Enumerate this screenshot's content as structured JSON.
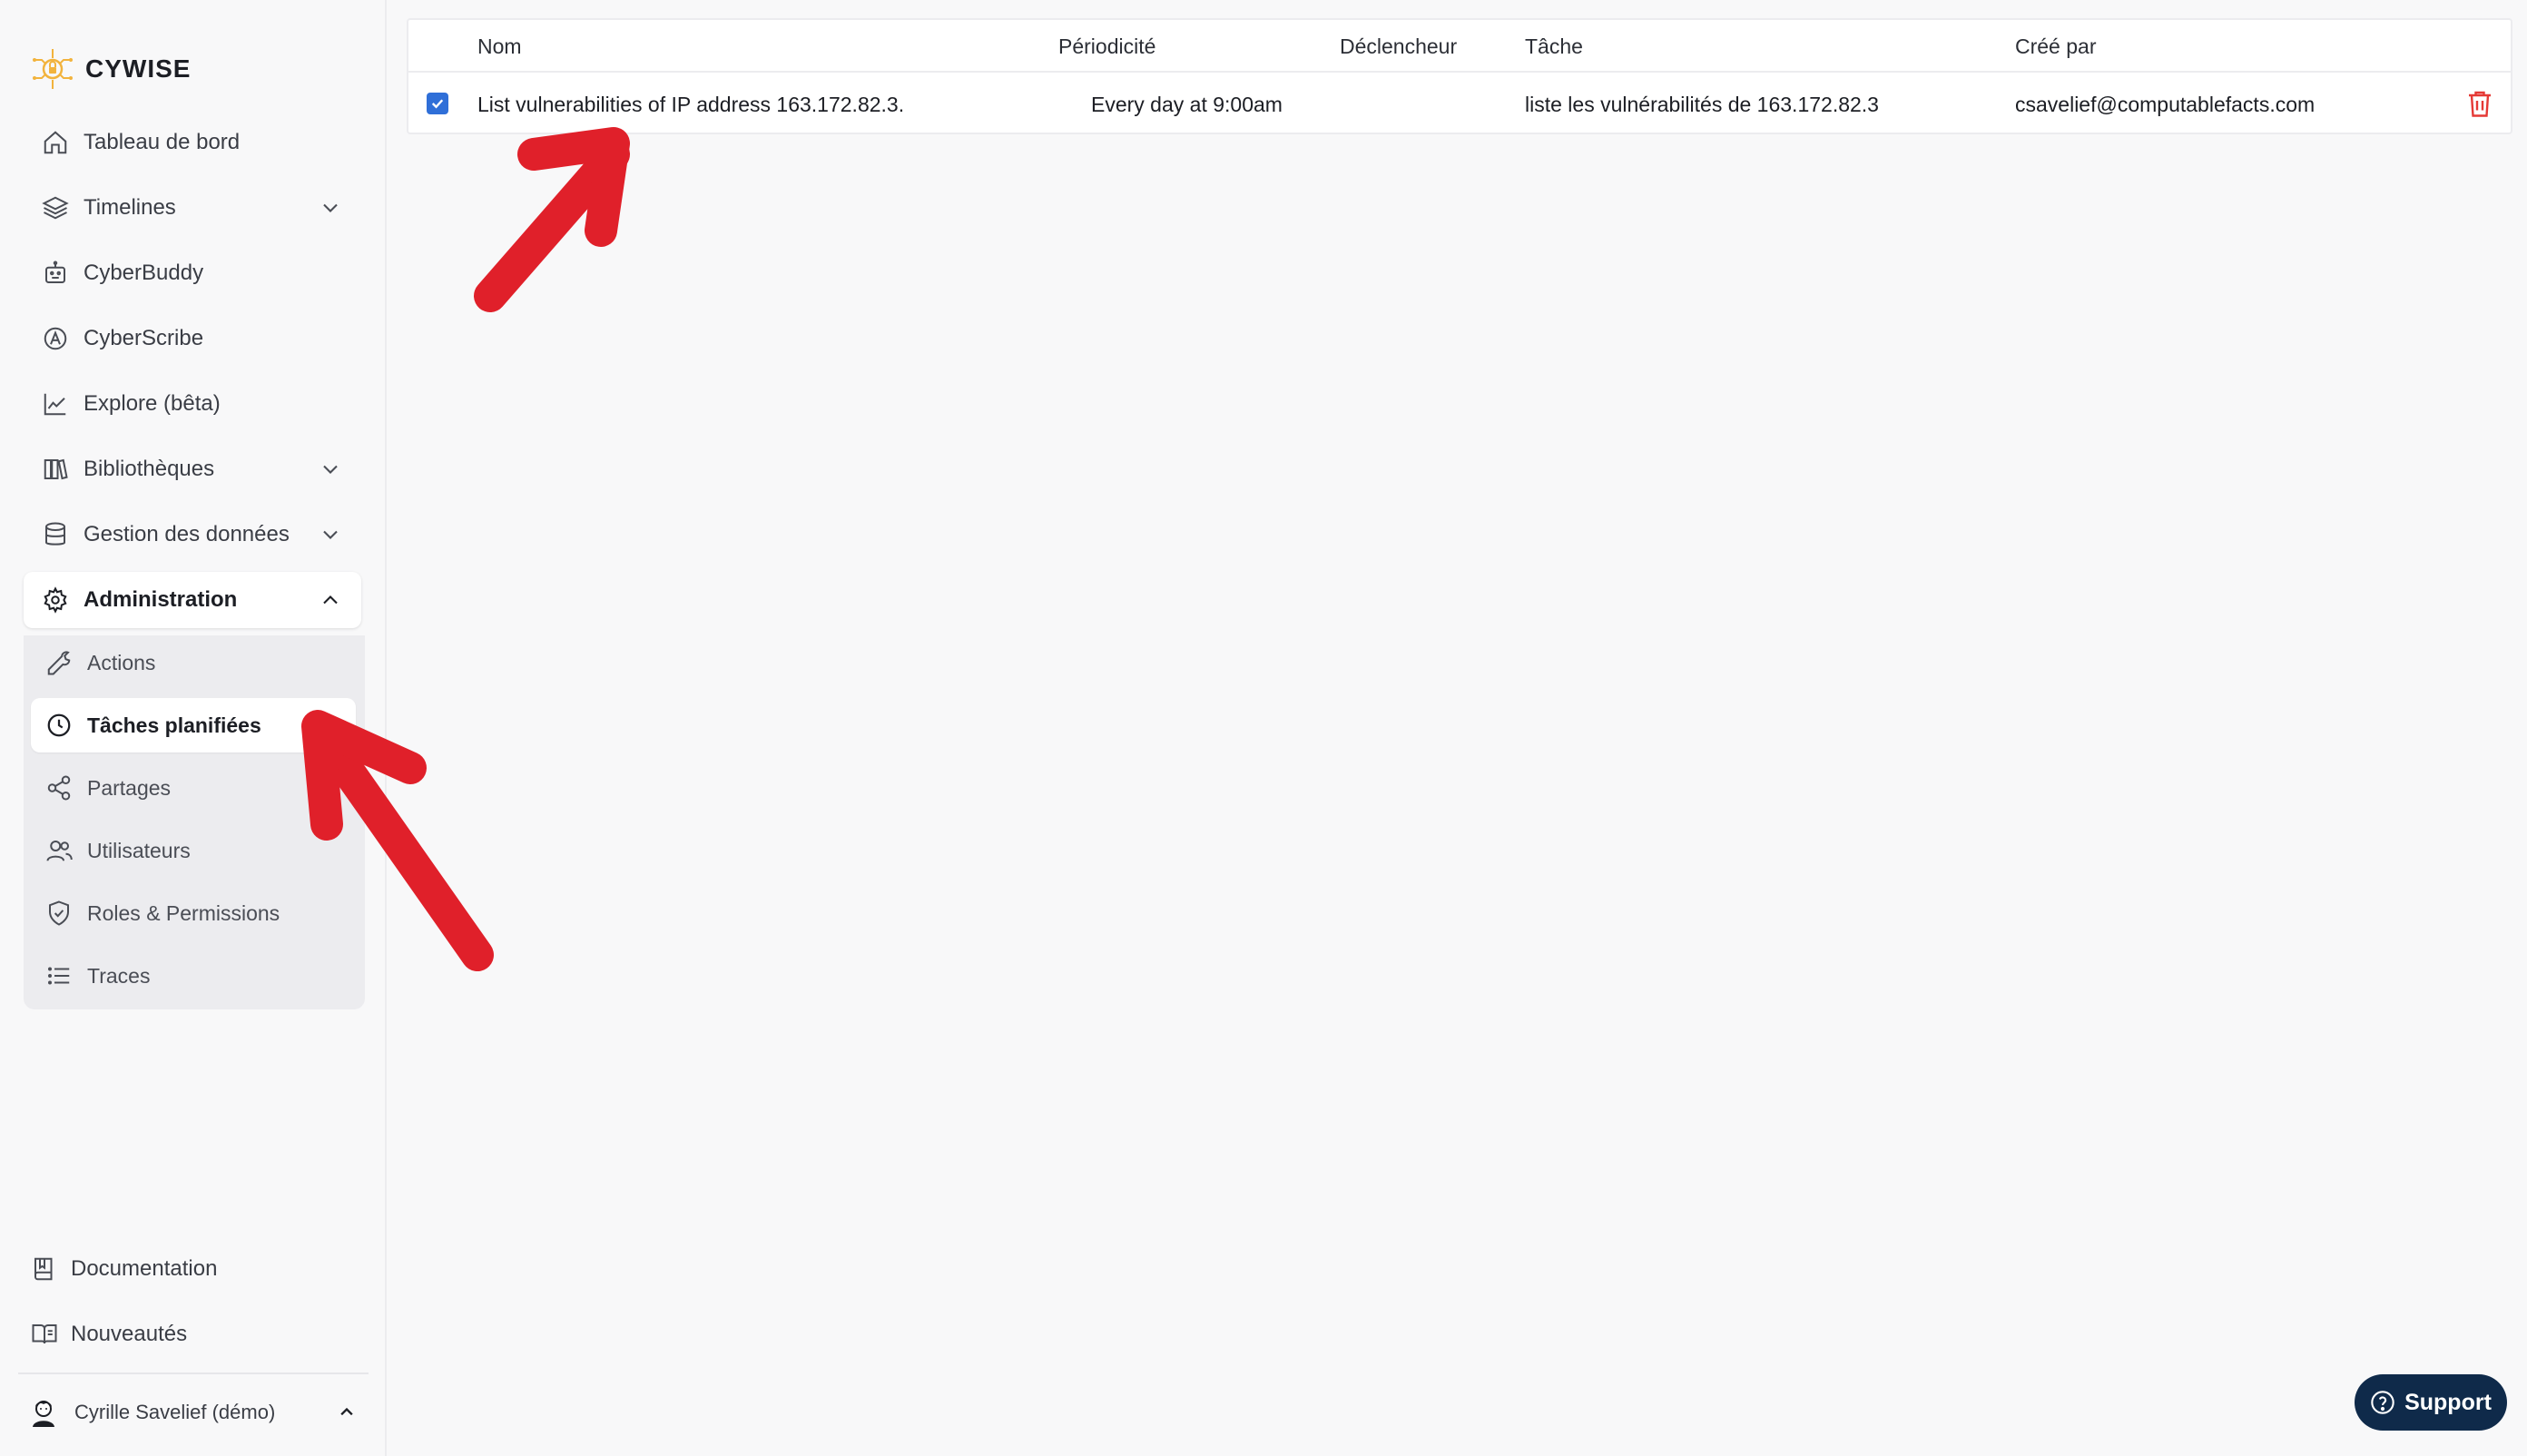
{
  "app": {
    "brand": "CYWISE"
  },
  "sidebar": {
    "items": [
      {
        "label": "Tableau de bord",
        "icon": "home-icon"
      },
      {
        "label": "Timelines",
        "icon": "layers-icon",
        "expandable": true
      },
      {
        "label": "CyberBuddy",
        "icon": "robot-icon"
      },
      {
        "label": "CyberScribe",
        "icon": "scribe-icon"
      },
      {
        "label": "Explore (bêta)",
        "icon": "chart-line-icon"
      },
      {
        "label": "Bibliothèques",
        "icon": "library-icon",
        "expandable": true
      },
      {
        "label": "Gestion des données",
        "icon": "database-icon",
        "expandable": true
      },
      {
        "label": "Administration",
        "icon": "gear-icon",
        "expanded": true
      }
    ],
    "admin_sub": [
      {
        "label": "Actions",
        "icon": "wrench-icon"
      },
      {
        "label": "Tâches planifiées",
        "icon": "clock-icon",
        "active": true
      },
      {
        "label": "Partages",
        "icon": "share-icon"
      },
      {
        "label": "Utilisateurs",
        "icon": "users-icon"
      },
      {
        "label": "Roles & Permissions",
        "icon": "shield-check-icon"
      },
      {
        "label": "Traces",
        "icon": "list-icon"
      }
    ],
    "bottom": [
      {
        "label": "Documentation",
        "icon": "book-icon"
      },
      {
        "label": "Nouveautés",
        "icon": "open-book-icon"
      }
    ],
    "user": {
      "name": "Cyrille Savelief (démo)"
    }
  },
  "table": {
    "headers": {
      "name": "Nom",
      "periodicity": "Périodicité",
      "trigger": "Déclencheur",
      "task": "Tâche",
      "created_by": "Créé par"
    },
    "rows": [
      {
        "checked": true,
        "name": "List vulnerabilities of IP address 163.172.82.3.",
        "periodicity": "Every day at 9:00am",
        "trigger": "",
        "task": "liste les vulnérabilités de 163.172.82.3",
        "created_by": "csavelief@computablefacts.com"
      }
    ]
  },
  "support": {
    "label": "Support"
  },
  "colors": {
    "accent": "#2f6fd8",
    "danger": "#e53935",
    "annotation": "#e0202a",
    "support_bg": "#0f2a4a",
    "logo": "#f2b33d"
  }
}
